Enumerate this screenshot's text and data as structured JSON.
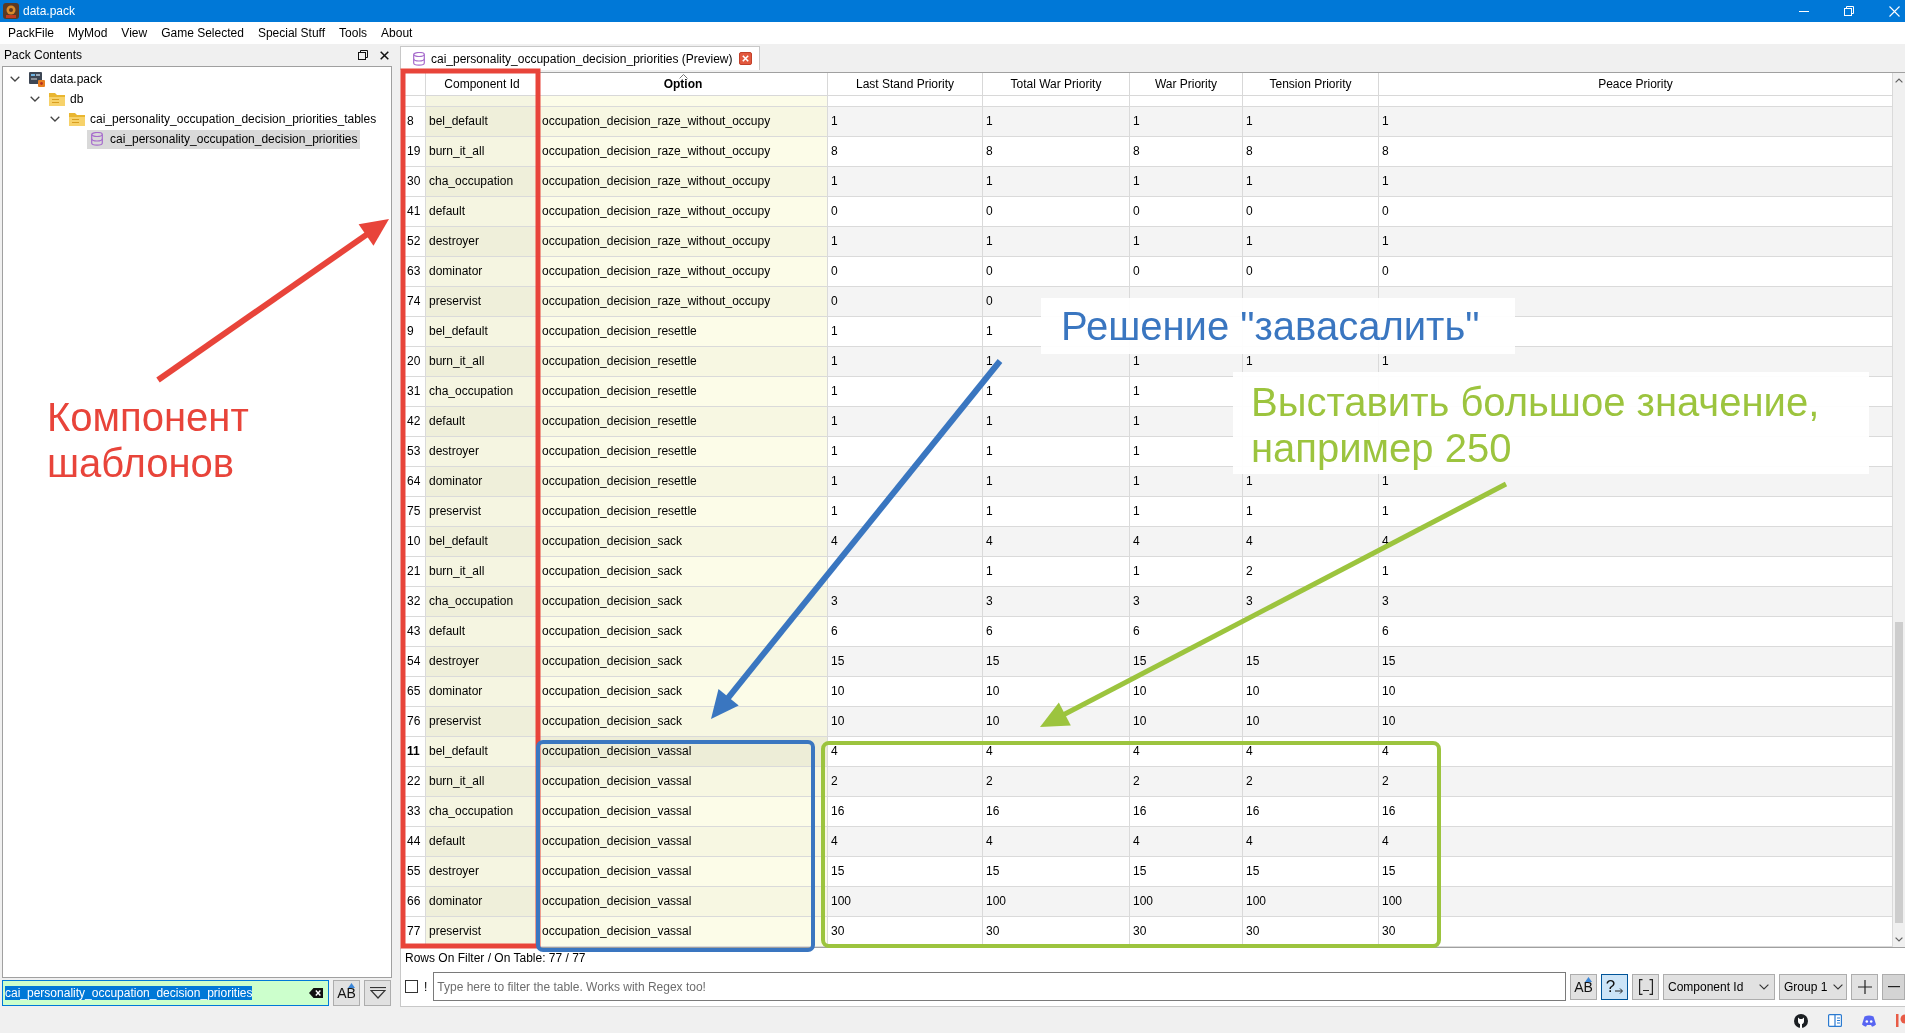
{
  "window": {
    "title": "data.pack"
  },
  "menu": [
    "PackFile",
    "MyMod",
    "View",
    "Game Selected",
    "Special Stuff",
    "Tools",
    "About"
  ],
  "pack_panel": {
    "title": "Pack Contents",
    "tree": [
      {
        "label": "data.pack",
        "kind": "pack",
        "expanded": true,
        "selected": false,
        "children": [
          {
            "label": "db",
            "kind": "folder",
            "expanded": true,
            "selected": false,
            "children": [
              {
                "label": "cai_personality_occupation_decision_priorities_tables",
                "kind": "folder",
                "expanded": true,
                "selected": false,
                "children": [
                  {
                    "label": "cai_personality_occupation_decision_priorities",
                    "kind": "table",
                    "selected": true
                  }
                ]
              }
            ]
          }
        ]
      }
    ],
    "search": {
      "value": "cai_personality_occupation_decision_priorities",
      "value_selected": true,
      "case_button": {
        "label": "AB",
        "on": false
      }
    }
  },
  "tabs": [
    {
      "label": "cai_personality_occupation_decision_priorities (Preview)",
      "selected": true
    }
  ],
  "table": {
    "columns": [
      {
        "label": "Component Id",
        "sorted": false
      },
      {
        "label": "Option",
        "sorted": true
      },
      {
        "label": "Last Stand Priority",
        "sorted": false
      },
      {
        "label": "Total War Priority",
        "sorted": false
      },
      {
        "label": "War Priority",
        "sorted": false
      },
      {
        "label": "Tension Priority",
        "sorted": false
      },
      {
        "label": "Peace Priority",
        "sorted": false
      }
    ],
    "rows": [
      {
        "number": "8",
        "selected": false,
        "component_id": "bel_default",
        "option": "occupation_decision_raze_without_occupy",
        "last_stand_priority": "1",
        "total_war_priority": "1",
        "war_priority": "1",
        "tension_priority": "1",
        "peace_priority": "1"
      },
      {
        "number": "19",
        "selected": false,
        "component_id": "burn_it_all",
        "option": "occupation_decision_raze_without_occupy",
        "last_stand_priority": "8",
        "total_war_priority": "8",
        "war_priority": "8",
        "tension_priority": "8",
        "peace_priority": "8"
      },
      {
        "number": "30",
        "selected": false,
        "component_id": "cha_occupation",
        "option": "occupation_decision_raze_without_occupy",
        "last_stand_priority": "1",
        "total_war_priority": "1",
        "war_priority": "1",
        "tension_priority": "1",
        "peace_priority": "1"
      },
      {
        "number": "41",
        "selected": false,
        "component_id": "default",
        "option": "occupation_decision_raze_without_occupy",
        "last_stand_priority": "0",
        "total_war_priority": "0",
        "war_priority": "0",
        "tension_priority": "0",
        "peace_priority": "0"
      },
      {
        "number": "52",
        "selected": false,
        "component_id": "destroyer",
        "option": "occupation_decision_raze_without_occupy",
        "last_stand_priority": "1",
        "total_war_priority": "1",
        "war_priority": "1",
        "tension_priority": "1",
        "peace_priority": "1"
      },
      {
        "number": "63",
        "selected": false,
        "component_id": "dominator",
        "option": "occupation_decision_raze_without_occupy",
        "last_stand_priority": "0",
        "total_war_priority": "0",
        "war_priority": "0",
        "tension_priority": "0",
        "peace_priority": "0"
      },
      {
        "number": "74",
        "selected": false,
        "component_id": "preservist",
        "option": "occupation_decision_raze_without_occupy",
        "last_stand_priority": "0",
        "total_war_priority": "0"
      },
      {
        "number": "9",
        "selected": false,
        "component_id": "bel_default",
        "option": "occupation_decision_resettle",
        "last_stand_priority": "1",
        "total_war_priority": "1"
      },
      {
        "number": "20",
        "selected": false,
        "component_id": "burn_it_all",
        "option": "occupation_decision_resettle",
        "last_stand_priority": "1",
        "total_war_priority": "1",
        "war_priority": "1",
        "tension_priority": "1",
        "peace_priority": "1"
      },
      {
        "number": "31",
        "selected": false,
        "component_id": "cha_occupation",
        "option": "occupation_decision_resettle",
        "last_stand_priority": "1",
        "total_war_priority": "1",
        "war_priority": "1"
      },
      {
        "number": "42",
        "selected": false,
        "component_id": "default",
        "option": "occupation_decision_resettle",
        "last_stand_priority": "1",
        "total_war_priority": "1",
        "war_priority": "1"
      },
      {
        "number": "53",
        "selected": false,
        "component_id": "destroyer",
        "option": "occupation_decision_resettle",
        "last_stand_priority": "1",
        "total_war_priority": "1",
        "war_priority": "1"
      },
      {
        "number": "64",
        "selected": false,
        "component_id": "dominator",
        "option": "occupation_decision_resettle",
        "last_stand_priority": "1",
        "total_war_priority": "1",
        "war_priority": "1",
        "tension_priority": "1",
        "peace_priority": "1"
      },
      {
        "number": "75",
        "selected": false,
        "component_id": "preservist",
        "option": "occupation_decision_resettle",
        "last_stand_priority": "1",
        "total_war_priority": "1",
        "war_priority": "1",
        "tension_priority": "1",
        "peace_priority": "1"
      },
      {
        "number": "10",
        "selected": false,
        "component_id": "bel_default",
        "option": "occupation_decision_sack",
        "last_stand_priority": "4",
        "total_war_priority": "4",
        "war_priority": "4",
        "tension_priority": "4",
        "peace_priority": "4"
      },
      {
        "number": "21",
        "selected": false,
        "component_id": "burn_it_all",
        "option": "occupation_decision_sack",
        "total_war_priority": "1",
        "war_priority": "1",
        "tension_priority": "2",
        "peace_priority": "1"
      },
      {
        "number": "32",
        "selected": false,
        "component_id": "cha_occupation",
        "option": "occupation_decision_sack",
        "last_stand_priority": "3",
        "total_war_priority": "3",
        "war_priority": "3",
        "tension_priority": "3",
        "peace_priority": "3"
      },
      {
        "number": "43",
        "selected": false,
        "component_id": "default",
        "option": "occupation_decision_sack",
        "last_stand_priority": "6",
        "total_war_priority": "6",
        "war_priority": "6",
        "peace_priority": "6"
      },
      {
        "number": "54",
        "selected": false,
        "component_id": "destroyer",
        "option": "occupation_decision_sack",
        "last_stand_priority": "15",
        "total_war_priority": "15",
        "war_priority": "15",
        "tension_priority": "15",
        "peace_priority": "15"
      },
      {
        "number": "65",
        "selected": false,
        "component_id": "dominator",
        "option": "occupation_decision_sack",
        "last_stand_priority": "10",
        "total_war_priority": "10",
        "war_priority": "10",
        "tension_priority": "10",
        "peace_priority": "10"
      },
      {
        "number": "76",
        "selected": false,
        "component_id": "preservist",
        "option": "occupation_decision_sack",
        "last_stand_priority": "10",
        "total_war_priority": "10",
        "war_priority": "10",
        "tension_priority": "10",
        "peace_priority": "10"
      },
      {
        "number": "11",
        "selected": true,
        "component_id": "bel_default",
        "option": "occupation_decision_vassal",
        "last_stand_priority": "4",
        "total_war_priority": "4",
        "war_priority": "4",
        "tension_priority": "4",
        "peace_priority": "4"
      },
      {
        "number": "22",
        "selected": false,
        "component_id": "burn_it_all",
        "option": "occupation_decision_vassal",
        "last_stand_priority": "2",
        "total_war_priority": "2",
        "war_priority": "2",
        "tension_priority": "2",
        "peace_priority": "2"
      },
      {
        "number": "33",
        "selected": false,
        "component_id": "cha_occupation",
        "option": "occupation_decision_vassal",
        "last_stand_priority": "16",
        "total_war_priority": "16",
        "war_priority": "16",
        "tension_priority": "16",
        "peace_priority": "16"
      },
      {
        "number": "44",
        "selected": false,
        "component_id": "default",
        "option": "occupation_decision_vassal",
        "last_stand_priority": "4",
        "total_war_priority": "4",
        "war_priority": "4",
        "tension_priority": "4",
        "peace_priority": "4"
      },
      {
        "number": "55",
        "selected": false,
        "component_id": "destroyer",
        "option": "occupation_decision_vassal",
        "last_stand_priority": "15",
        "total_war_priority": "15",
        "war_priority": "15",
        "tension_priority": "15",
        "peace_priority": "15"
      },
      {
        "number": "66",
        "selected": false,
        "component_id": "dominator",
        "option": "occupation_decision_vassal",
        "last_stand_priority": "100",
        "total_war_priority": "100",
        "war_priority": "100",
        "tension_priority": "100",
        "peace_priority": "100"
      },
      {
        "number": "77",
        "selected": false,
        "component_id": "preservist",
        "option": "occupation_decision_vassal",
        "last_stand_priority": "30",
        "total_war_priority": "30",
        "war_priority": "30",
        "tension_priority": "30",
        "peace_priority": "30"
      }
    ],
    "row_count": "Rows On Filter / On Table: 77 / 77"
  },
  "filter": {
    "negate": {
      "label": "!",
      "checked": false
    },
    "placeholder": "Type here to filter the table. Works with Regex too!",
    "case_button": {
      "label": "AB",
      "on": false
    },
    "regex_button": {
      "label": "?",
      "on": true
    },
    "whitespace_button": {
      "on": false
    },
    "column": "Component Id",
    "group": "Group 1"
  },
  "annotations": [
    {
      "text": "Компонент шаблонов",
      "color": "#e8443a"
    },
    {
      "text": "Решение \"завасалить\"",
      "color": "#3a76c0"
    },
    {
      "text": "Выставить большое значение, например 250",
      "color": "#9cc43e"
    }
  ]
}
